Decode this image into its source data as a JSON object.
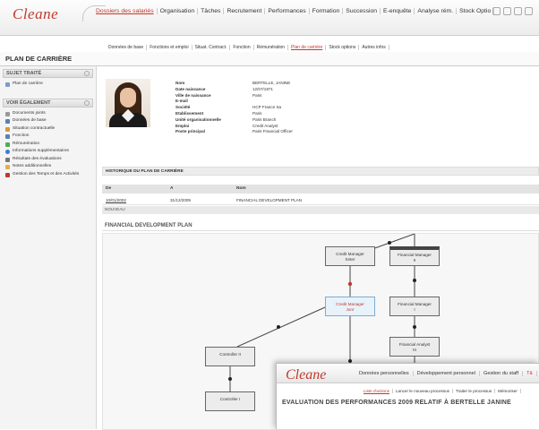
{
  "app": {
    "logo": "Cleane"
  },
  "main_nav": [
    {
      "label": "Dossiers des salariés",
      "active": true
    },
    {
      "label": "Organisation",
      "active": false
    },
    {
      "label": "Tâches",
      "active": false
    },
    {
      "label": "Recrutement",
      "active": false
    },
    {
      "label": "Performances",
      "active": false
    },
    {
      "label": "Formation",
      "active": false
    },
    {
      "label": "Succession",
      "active": false
    },
    {
      "label": "E-enquête",
      "active": false
    },
    {
      "label": "Analyse rém.",
      "active": false
    },
    {
      "label": "Stock Optio",
      "active": false
    }
  ],
  "sub_nav": [
    {
      "label": "Données de base",
      "active": false
    },
    {
      "label": "Fonctions et emploi",
      "active": false
    },
    {
      "label": "Situat. Contract.",
      "active": false
    },
    {
      "label": "Fonction",
      "active": false
    },
    {
      "label": "Rémunération",
      "active": false
    },
    {
      "label": "Plan de carrière",
      "active": true
    },
    {
      "label": "Stock options",
      "active": false
    },
    {
      "label": "Autres infos",
      "active": false
    }
  ],
  "page_title": "PLAN DE CARRIÈRE",
  "sidebar": {
    "section1_title": "SUJET TRAITÉ",
    "section1_items": [
      {
        "label": "Plan de carrière",
        "icon": "document-icon",
        "color": "#7a9cc6"
      }
    ],
    "section2_title": "VOIR ÉGALEMENT",
    "section2_items": [
      {
        "label": "Documents joints",
        "icon": "paperclip-icon",
        "color": "#999999"
      },
      {
        "label": "Données de base",
        "icon": "people-icon",
        "color": "#5a7fb5"
      },
      {
        "label": "Situation contractuelle",
        "icon": "contract-icon",
        "color": "#d19a3a"
      },
      {
        "label": "Fonction",
        "icon": "person-icon",
        "color": "#5a7fb5"
      },
      {
        "label": "Rémunération",
        "icon": "money-icon",
        "color": "#4caf50"
      },
      {
        "label": "Informations supplémentaires",
        "icon": "info-icon",
        "color": "#3a7bd5"
      },
      {
        "label": "Résultats des évaluations",
        "icon": "results-icon",
        "color": "#777777"
      },
      {
        "label": "Notes additionnelles",
        "icon": "note-icon",
        "color": "#d9b24a"
      },
      {
        "label": "Gestion des Temps et des Activités",
        "icon": "calendar-icon",
        "color": "#c0392b"
      }
    ]
  },
  "employee": {
    "rows": [
      {
        "label": "Nom",
        "value": "BERTELLE, JANINE"
      },
      {
        "label": "Date naissance",
        "value": "12/07/1971"
      },
      {
        "label": "Ville de naissance",
        "value": "Paris"
      },
      {
        "label": "E-mail",
        "value": ""
      },
      {
        "label": "Société",
        "value": "HCP France Sa"
      },
      {
        "label": "Etablissement",
        "value": "Paris"
      },
      {
        "label": "Unité organisationnelle",
        "value": "Paris Branch"
      },
      {
        "label": "Emploi",
        "value": "Credit Analyst"
      },
      {
        "label": "Poste principal",
        "value": "Paris Financial Officer"
      }
    ]
  },
  "history": {
    "title": "HISTORIQUE DU PLAN DE CARRIÈRE",
    "col_from": "De",
    "col_to": "A",
    "col_name": "Nom",
    "rows": [
      {
        "from": "10/01/2002",
        "to": "31/12/2009",
        "name": "FINANCIAL DEVELOPMENT PLAN"
      }
    ],
    "new_label": "NOUVEAU"
  },
  "plan": {
    "title": "FINANCIAL DEVELOPMENT PLAN",
    "nodes": [
      {
        "label": "Credit Manager",
        "sub": "Snter"
      },
      {
        "label": "Financial Manager",
        "sub": "II"
      },
      {
        "label": "Credit Manager",
        "sub": "Junr"
      },
      {
        "label": "Financial Manager",
        "sub": "I"
      },
      {
        "label": "Controller II",
        "sub": ""
      },
      {
        "label": "Financial Analyst",
        "sub": "III"
      },
      {
        "label": "Controller I",
        "sub": ""
      }
    ]
  },
  "overlay": {
    "logo": "Cleane",
    "nav": [
      {
        "label": "Données personnelles",
        "active": false
      },
      {
        "label": "Développement personnel",
        "active": false
      },
      {
        "label": "Gestion du staff",
        "active": false
      },
      {
        "label": "Tâ",
        "active": true
      }
    ],
    "sub": [
      {
        "label": "Liste d'actions",
        "active": true
      },
      {
        "label": "Lancer le nouveau processus",
        "active": false
      },
      {
        "label": "Traiter le processus",
        "active": false
      },
      {
        "label": "Mémoriser",
        "active": false
      }
    ],
    "title": "EVALUATION DES PERFORMANCES 2009 RELATIF À BERTELLE JANINE"
  }
}
